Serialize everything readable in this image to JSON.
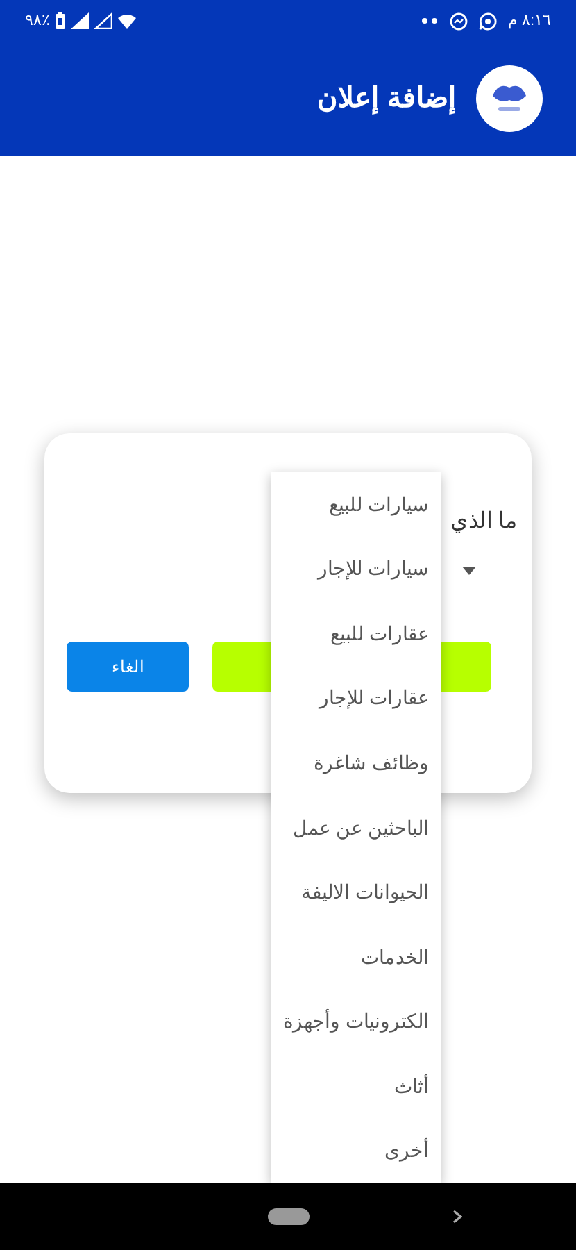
{
  "status_bar": {
    "time": "٨:١٦ م",
    "battery": "٪٩٨"
  },
  "header": {
    "title": "إضافة إعلان"
  },
  "dialog": {
    "label": "ما الذي",
    "cancel_button": "الغاء"
  },
  "dropdown": {
    "items": [
      {
        "label": "سيارات للبيع"
      },
      {
        "label": "سيارات للإجار"
      },
      {
        "label": "عقارات للبيع"
      },
      {
        "label": "عقارات للإجار"
      },
      {
        "label": "وظائف شاغرة"
      },
      {
        "label": "الباحثين عن عمل"
      },
      {
        "label": "الحيوانات الاليفة"
      },
      {
        "label": "الخدمات"
      },
      {
        "label": "الكترونيات وأجهزة"
      },
      {
        "label": "أثاث"
      },
      {
        "label": "أخرى"
      }
    ]
  }
}
